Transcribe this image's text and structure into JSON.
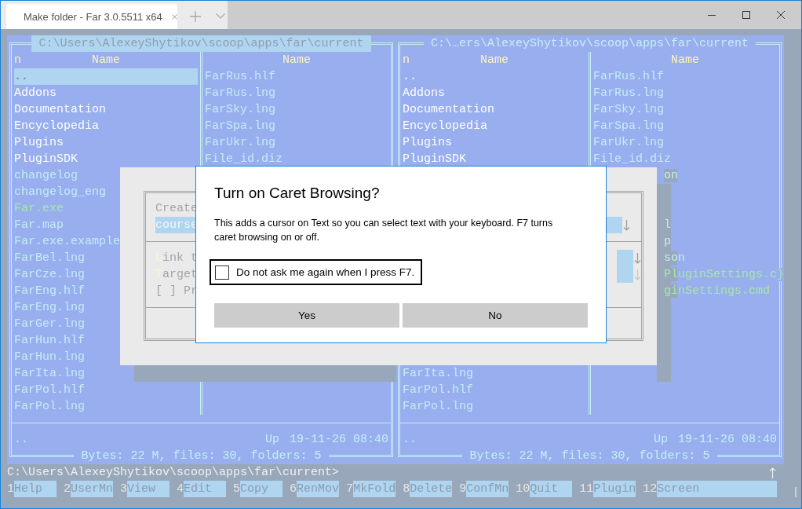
{
  "window": {
    "tab_title": "Make folder - Far 3.0.5511 x64"
  },
  "panels": [
    {
      "selected": true,
      "title": "C:\\Users\\AlexeyShytikov\\scoop\\apps\\far\\current",
      "header": {
        "mode": "n",
        "columns": [
          "Name",
          "Name"
        ]
      },
      "column_a": {
        "files": [
          {
            "name": "..",
            "kind": "dir",
            "selected": true
          },
          {
            "name": "Addons",
            "kind": "dir",
            "selected": false
          },
          {
            "name": "Documentation",
            "kind": "dir",
            "selected": false
          },
          {
            "name": "Encyclopedia",
            "kind": "dir",
            "selected": false
          },
          {
            "name": "Plugins",
            "kind": "dir",
            "selected": false
          },
          {
            "name": "PluginSDK",
            "kind": "dir",
            "selected": false
          },
          {
            "name": "changelog",
            "kind": "file",
            "selected": false
          },
          {
            "name": "changelog_eng",
            "kind": "file",
            "selected": false
          },
          {
            "name": "Far.exe",
            "kind": "exe",
            "selected": false
          },
          {
            "name": "Far.map",
            "kind": "file",
            "selected": false
          },
          {
            "name": "Far.exe.example",
            "kind": "file",
            "selected": false
          },
          {
            "name": "FarBel.lng",
            "kind": "file",
            "selected": false
          },
          {
            "name": "FarCze.lng",
            "kind": "file",
            "selected": false
          },
          {
            "name": "FarEng.hlf",
            "kind": "file",
            "selected": false
          },
          {
            "name": "FarEng.lng",
            "kind": "file",
            "selected": false
          },
          {
            "name": "FarGer.lng",
            "kind": "file",
            "selected": false
          },
          {
            "name": "FarHun.hlf",
            "kind": "file",
            "selected": false
          },
          {
            "name": "FarHun.lng",
            "kind": "file",
            "selected": false
          },
          {
            "name": "FarIta.lng",
            "kind": "file",
            "selected": false
          },
          {
            "name": "FarPol.hlf",
            "kind": "file",
            "selected": false
          },
          {
            "name": "FarPol.lng",
            "kind": "file",
            "selected": false
          }
        ]
      },
      "column_b": {
        "files": [
          {
            "name": "FarRus.hlf",
            "kind": "file",
            "selected": false
          },
          {
            "name": "FarRus.lng",
            "kind": "file",
            "selected": false
          },
          {
            "name": "FarSky.lng",
            "kind": "file",
            "selected": false
          },
          {
            "name": "FarSpa.lng",
            "kind": "file",
            "selected": false
          },
          {
            "name": "FarUkr.lng",
            "kind": "file",
            "selected": false
          },
          {
            "name": "File_id.diz",
            "kind": "file",
            "selected": false
          }
        ]
      },
      "info": {
        "name": "..",
        "type": "Up",
        "date": "19-11-26 08:40"
      },
      "totals": "Bytes: 22 M, files: 30, folders: 5"
    },
    {
      "selected": false,
      "title": "C:\\…ers\\AlexeyShytikov\\scoop\\apps\\far\\current",
      "header": {
        "mode": "n",
        "columns": [
          "Name",
          "Name"
        ]
      },
      "column_a": {
        "files": [
          {
            "name": "..",
            "kind": "dir",
            "selected": false
          },
          {
            "name": "Addons",
            "kind": "dir",
            "selected": false
          },
          {
            "name": "Documentation",
            "kind": "dir",
            "selected": false
          },
          {
            "name": "Encyclopedia",
            "kind": "dir",
            "selected": false
          },
          {
            "name": "Plugins",
            "kind": "dir",
            "selected": false
          },
          {
            "name": "PluginSDK",
            "kind": "dir",
            "selected": false
          }
        ],
        "files_end": [
          {
            "name": "FarIta.lng",
            "kind": "file",
            "selected": false
          },
          {
            "name": "FarPol.hlf",
            "kind": "file",
            "selected": false
          },
          {
            "name": "FarPol.lng",
            "kind": "file",
            "selected": false
          }
        ]
      },
      "column_b": {
        "files": [
          {
            "name": "FarRus.hlf",
            "kind": "file",
            "selected": false
          },
          {
            "name": "FarRus.lng",
            "kind": "file",
            "selected": false
          },
          {
            "name": "FarSky.lng",
            "kind": "file",
            "selected": false
          },
          {
            "name": "FarSpa.lng",
            "kind": "file",
            "selected": false
          },
          {
            "name": "FarUkr.lng",
            "kind": "file",
            "selected": false
          },
          {
            "name": "File_id.diz",
            "kind": "file",
            "selected": false
          }
        ],
        "fragments": [
          {
            "text": "on",
            "kind": "file"
          }
        ],
        "fragments_lower": [
          {
            "text": "l",
            "kind": "file"
          },
          {
            "text": "p",
            "kind": "file"
          },
          {
            "text": "son",
            "kind": "file"
          },
          {
            "text": "PluginSettings.c}",
            "kind": "exe"
          },
          {
            "text": "ginSettings.cmd",
            "kind": "exe"
          }
        ]
      },
      "info": {
        "name": "..",
        "type": "Up",
        "date": "19-11-26 08:40"
      },
      "totals": "Bytes: 22 M, files: 30, folders: 5"
    }
  ],
  "far_dialog": {
    "caption": "Create",
    "input": "course",
    "link_label": "Link t",
    "target_label": "Target",
    "option": "[ ] Pr"
  },
  "prompt_dialog": {
    "title": "Turn on Caret Browsing?",
    "message": "This adds a cursor on Text so you can select text with your keyboard. F7 turns caret browsing on or off.",
    "checkbox": {
      "label": "Do not ask me again when I press F7.",
      "checked": false
    },
    "buttons": [
      "Yes",
      "No"
    ]
  },
  "command_line": "C:\\Users\\AlexeyShytikov\\scoop\\apps\\far\\current>",
  "keybar": [
    {
      "key": "1",
      "label": "Help"
    },
    {
      "key": "2",
      "label": "UserMn"
    },
    {
      "key": "3",
      "label": "View"
    },
    {
      "key": "4",
      "label": "Edit"
    },
    {
      "key": "5",
      "label": "Copy"
    },
    {
      "key": "6",
      "label": "RenMov"
    },
    {
      "key": "7",
      "label": "MkFold"
    },
    {
      "key": "8",
      "label": "Delete"
    },
    {
      "key": "9",
      "label": "ConfMn"
    },
    {
      "key": "10",
      "label": "Quit"
    },
    {
      "key": "11",
      "label": "Plugin"
    },
    {
      "key": "12",
      "label": "Screen"
    }
  ]
}
